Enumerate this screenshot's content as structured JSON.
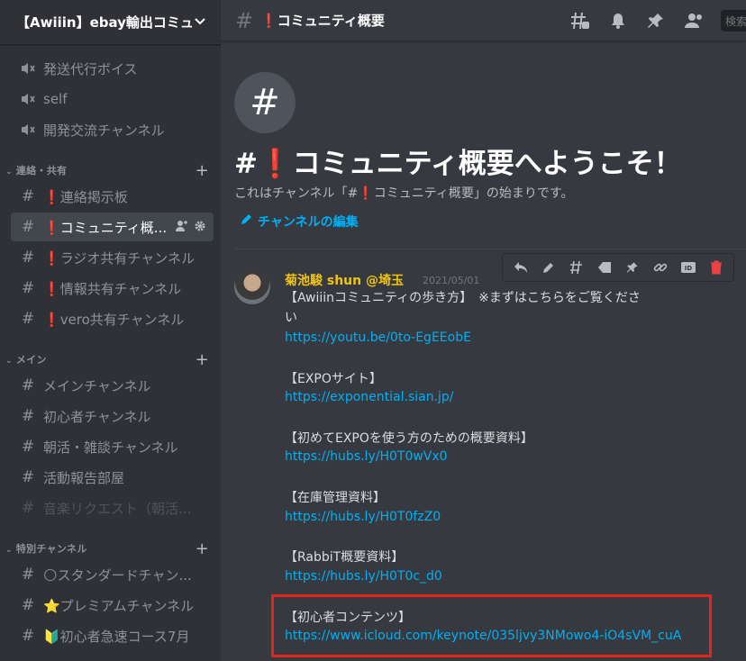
{
  "server": {
    "name": "【Awiiin】ebay輸出コミュ..."
  },
  "sidebar": {
    "voice_channels": [
      {
        "label": "発送代行ボイス"
      },
      {
        "label": "self"
      },
      {
        "label": "開発交流チャンネル"
      }
    ],
    "categories": [
      {
        "name": "連絡・共有"
      },
      {
        "name": "メイン"
      },
      {
        "name": "特別チャンネル"
      }
    ],
    "contact_channels": [
      {
        "label": "連絡掲示板",
        "mark": "❗"
      },
      {
        "label": "コミュニティ概...",
        "mark": "❗"
      },
      {
        "label": "ラジオ共有チャンネル",
        "mark": "❗"
      },
      {
        "label": "情報共有チャンネル",
        "mark": "❗"
      },
      {
        "label": "vero共有チャンネル",
        "mark": "❗"
      }
    ],
    "main_channels": [
      {
        "label": "メインチャンネル"
      },
      {
        "label": "初心者チャンネル"
      },
      {
        "label": "朝活・雑談チャンネル"
      },
      {
        "label": "活動報告部屋"
      },
      {
        "label": "音楽リクエスト（朝活..."
      }
    ],
    "special_channels": [
      {
        "label": "🌕スタンダードチャン..."
      },
      {
        "label": "⭐プレミアムチャンネル"
      },
      {
        "label": "🔰初心者急速コース7月"
      }
    ]
  },
  "header": {
    "mark": "❗",
    "title": "コミュニティ概要",
    "search_placeholder": "検索"
  },
  "welcome": {
    "title_prefix": "#",
    "title_mark": "❗",
    "title_text": "コミュニティ概要へようこそ！",
    "subtitle": "これはチャンネル「#❗コミュニティ概要」の始まりです。",
    "edit_label": "チャンネルの編集"
  },
  "message": {
    "author": "菊池駿 shun @埼玉",
    "timestamp": "2021/05/01",
    "lines": [
      {
        "text": "【Awiiinコミュニティの歩き方】　※まずはこちらをご覧くださ",
        "type": "text"
      },
      {
        "text": "い",
        "type": "text"
      },
      {
        "text": "https://youtu.be/0to-EgEEobE",
        "type": "link"
      },
      {
        "text": "【EXPOサイト】",
        "type": "text"
      },
      {
        "text": "https://exponential.sian.jp/",
        "type": "link"
      },
      {
        "text": "【初めてEXPOを使う方のための概要資料】",
        "type": "text"
      },
      {
        "text": "https://hubs.ly/H0T0wVx0",
        "type": "link"
      },
      {
        "text": "【在庫管理資料】",
        "type": "text"
      },
      {
        "text": "https://hubs.ly/H0T0fzZ0",
        "type": "link"
      },
      {
        "text": "【RabbiT概要資料】",
        "type": "text"
      },
      {
        "text": "https://hubs.ly/H0T0c_d0",
        "type": "link"
      },
      {
        "text": "【初心者コンテンツ】",
        "type": "text"
      },
      {
        "text": "https://www.icloud.com/keynote/035ljvy3NMowo4-iO4sVM_cuA",
        "type": "link"
      }
    ]
  },
  "colors": {
    "accent_link": "#00b0f4",
    "author": "#f1c40f",
    "highlight": "#e5251b"
  }
}
